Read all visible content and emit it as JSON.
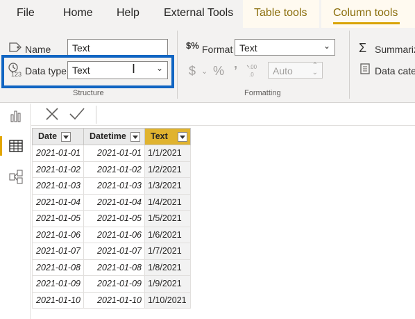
{
  "menu": {
    "file": "File",
    "home": "Home",
    "help": "Help",
    "external_tools": "External Tools",
    "table_tools": "Table tools",
    "column_tools": "Column tools"
  },
  "ribbon": {
    "name_label": "Name",
    "name_value": "Text",
    "datatype_label": "Data type",
    "datatype_value": "Text",
    "structure_label": "Structure",
    "format_label": "Format",
    "format_value": "Text",
    "dollar": "$",
    "percent": "%",
    "comma": "9",
    "decimals_value": "Auto",
    "formatting_label": "Formatting",
    "summarize_label": "Summariz",
    "datacategory_label": "Data categ"
  },
  "table": {
    "columns": [
      "Date",
      "Datetime",
      "Text"
    ],
    "rows": [
      [
        "2021-01-01",
        "2021-01-01",
        "1/1/2021"
      ],
      [
        "2021-01-02",
        "2021-01-02",
        "1/2/2021"
      ],
      [
        "2021-01-03",
        "2021-01-03",
        "1/3/2021"
      ],
      [
        "2021-01-04",
        "2021-01-04",
        "1/4/2021"
      ],
      [
        "2021-01-05",
        "2021-01-05",
        "1/5/2021"
      ],
      [
        "2021-01-06",
        "2021-01-06",
        "1/6/2021"
      ],
      [
        "2021-01-07",
        "2021-01-07",
        "1/7/2021"
      ],
      [
        "2021-01-08",
        "2021-01-08",
        "1/8/2021"
      ],
      [
        "2021-01-09",
        "2021-01-09",
        "1/9/2021"
      ],
      [
        "2021-01-10",
        "2021-01-10",
        "1/10/2021"
      ]
    ]
  },
  "icons": {
    "name": "tag-icon",
    "datatype": "clock-123-icon",
    "format": "dollar-percent-icon",
    "summarize": "sigma-icon",
    "datacategory": "data-category-icon",
    "cancel": "close-icon",
    "commit": "check-icon",
    "report": "bar-chart-icon",
    "data": "table-grid-icon",
    "model": "model-icon"
  },
  "colors": {
    "accent": "#e0b32f",
    "highlight": "#1065c2",
    "context_tab": "#8a6d0b"
  }
}
